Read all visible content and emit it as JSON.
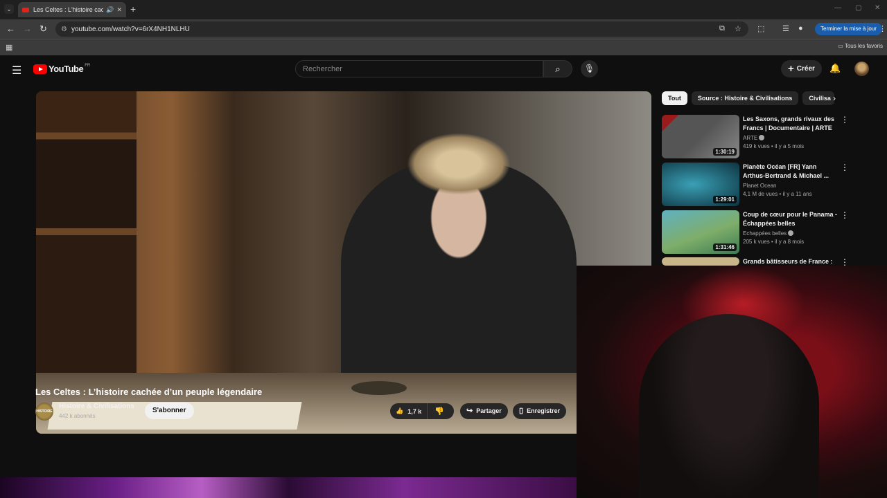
{
  "browser": {
    "tab_title": "Les Celtes : L'histoire cachée",
    "url": "youtube.com/watch?v=6rX4NH1NLHU",
    "update_button": "Terminer la mise à jour",
    "bookmarks_all": "Tous les favoris"
  },
  "header": {
    "logo": "YouTube",
    "country": "FR",
    "search_placeholder": "Rechercher",
    "create_label": "Créer"
  },
  "video": {
    "title": "Les Celtes : L’histoire cachée d’un peuple légendaire",
    "channel": "Histoire & Civilisations",
    "channel_avatar_text": "HISTOIRE",
    "subscribers": "442 k abonnés",
    "subscribe_label": "S'abonner",
    "likes": "1,7 k",
    "share_label": "Partager",
    "save_label": "Enregistrer"
  },
  "chips": [
    "Tout",
    "Source : Histoire & Civilisations",
    "Civilisa"
  ],
  "recommendations": [
    {
      "title": "Les Saxons, grands rivaux des Francs | Documentaire | ARTE",
      "channel": "ARTE",
      "verified": true,
      "meta": "419 k vues • il y a 5 mois",
      "duration": "1:30:19",
      "thumb_color": "#6b6b6b"
    },
    {
      "title": "Planète Océan [FR] Yann Arthus-Bertrand & Michael ...",
      "channel": "Planet Ocean",
      "verified": false,
      "meta": "4,1 M de vues • il y a 11 ans",
      "duration": "1:29:01",
      "thumb_color": "#1e5a6a"
    },
    {
      "title": "Coup de cœur pour le Panama - Échappées belles",
      "channel": "Echappées belles",
      "verified": true,
      "meta": "205 k vues • il y a 8 mois",
      "duration": "1:31:46",
      "thumb_color": "#4a9a6a"
    },
    {
      "title": "Grands bâtisseurs de France :",
      "channel": "",
      "verified": false,
      "meta": "",
      "duration": "",
      "thumb_color": "#c8b68a"
    }
  ],
  "colors": {
    "brand_red": "#ff0000",
    "update_blue": "#1a5dab"
  }
}
